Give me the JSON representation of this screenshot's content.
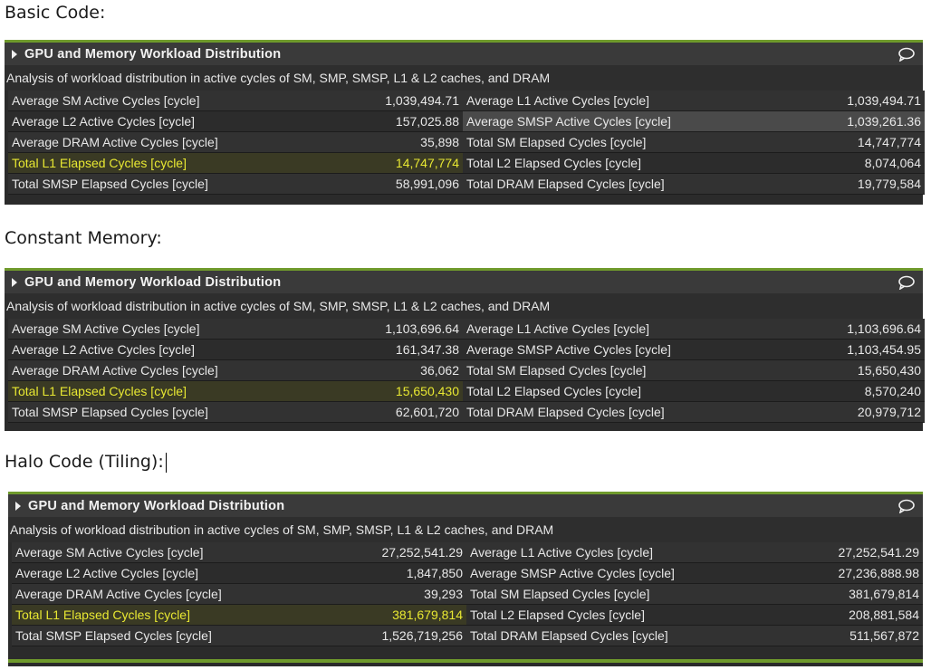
{
  "sections": [
    {
      "caption": "Basic Code:",
      "title": "GPU and Memory Workload Distribution",
      "description": "Analysis of workload distribution in active cycles of SM, SMP, SMSP, L1 & L2 caches, and DRAM",
      "rows": [
        {
          "l1": "Average SM Active Cycles [cycle]",
          "v1": "1,039,494.71",
          "l2": "Average L1 Active Cycles [cycle]",
          "v2": "1,039,494.71"
        },
        {
          "l1": "Average L2 Active Cycles [cycle]",
          "v1": "157,025.88",
          "l2": "Average SMSP Active Cycles [cycle]",
          "v2": "1,039,261.36"
        },
        {
          "l1": "Average DRAM Active Cycles [cycle]",
          "v1": "35,898",
          "l2": "Total SM Elapsed Cycles [cycle]",
          "v2": "14,747,774"
        },
        {
          "l1": "Total L1 Elapsed Cycles [cycle]",
          "v1": "14,747,774",
          "l2": "Total L2 Elapsed Cycles [cycle]",
          "v2": "8,074,064"
        },
        {
          "l1": "Total SMSP Elapsed Cycles [cycle]",
          "v1": "58,991,096",
          "l2": "Total DRAM Elapsed Cycles [cycle]",
          "v2": "19,779,584"
        }
      ]
    },
    {
      "caption": "Constant Memory:",
      "title": "GPU and Memory Workload Distribution",
      "description": "Analysis of workload distribution in active cycles of SM, SMP, SMSP, L1 & L2 caches, and DRAM",
      "rows": [
        {
          "l1": "Average SM Active Cycles [cycle]",
          "v1": "1,103,696.64",
          "l2": "Average L1 Active Cycles [cycle]",
          "v2": "1,103,696.64"
        },
        {
          "l1": "Average L2 Active Cycles [cycle]",
          "v1": "161,347.38",
          "l2": "Average SMSP Active Cycles [cycle]",
          "v2": "1,103,454.95"
        },
        {
          "l1": "Average DRAM Active Cycles [cycle]",
          "v1": "36,062",
          "l2": "Total SM Elapsed Cycles [cycle]",
          "v2": "15,650,430"
        },
        {
          "l1": "Total L1 Elapsed Cycles [cycle]",
          "v1": "15,650,430",
          "l2": "Total L2 Elapsed Cycles [cycle]",
          "v2": "8,570,240"
        },
        {
          "l1": "Total SMSP Elapsed Cycles [cycle]",
          "v1": "62,601,720",
          "l2": "Total DRAM Elapsed Cycles [cycle]",
          "v2": "20,979,712"
        }
      ]
    },
    {
      "caption": "Halo Code (Tiling):",
      "title": "GPU and Memory Workload Distribution",
      "description": "Analysis of workload distribution in active cycles of SM, SMP, SMSP, L1 & L2 caches, and DRAM",
      "rows": [
        {
          "l1": "Average SM Active Cycles [cycle]",
          "v1": "27,252,541.29",
          "l2": "Average L1 Active Cycles [cycle]",
          "v2": "27,252,541.29"
        },
        {
          "l1": "Average L2 Active Cycles [cycle]",
          "v1": "1,847,850",
          "l2": "Average SMSP Active Cycles [cycle]",
          "v2": "27,236,888.98"
        },
        {
          "l1": "Average DRAM Active Cycles [cycle]",
          "v1": "39,293",
          "l2": "Total SM Elapsed Cycles [cycle]",
          "v2": "381,679,814"
        },
        {
          "l1": "Total L1 Elapsed Cycles [cycle]",
          "v1": "381,679,814",
          "l2": "Total L2 Elapsed Cycles [cycle]",
          "v2": "208,881,584"
        },
        {
          "l1": "Total SMSP Elapsed Cycles [cycle]",
          "v1": "1,526,719,256",
          "l2": "Total DRAM Elapsed Cycles [cycle]",
          "v2": "511,567,872"
        }
      ]
    }
  ],
  "highlight_row": 3,
  "colors": {
    "accent_green": "#6f9a2c",
    "highlight_text": "#e8e832",
    "panel_bg": "#2b2b2b"
  }
}
